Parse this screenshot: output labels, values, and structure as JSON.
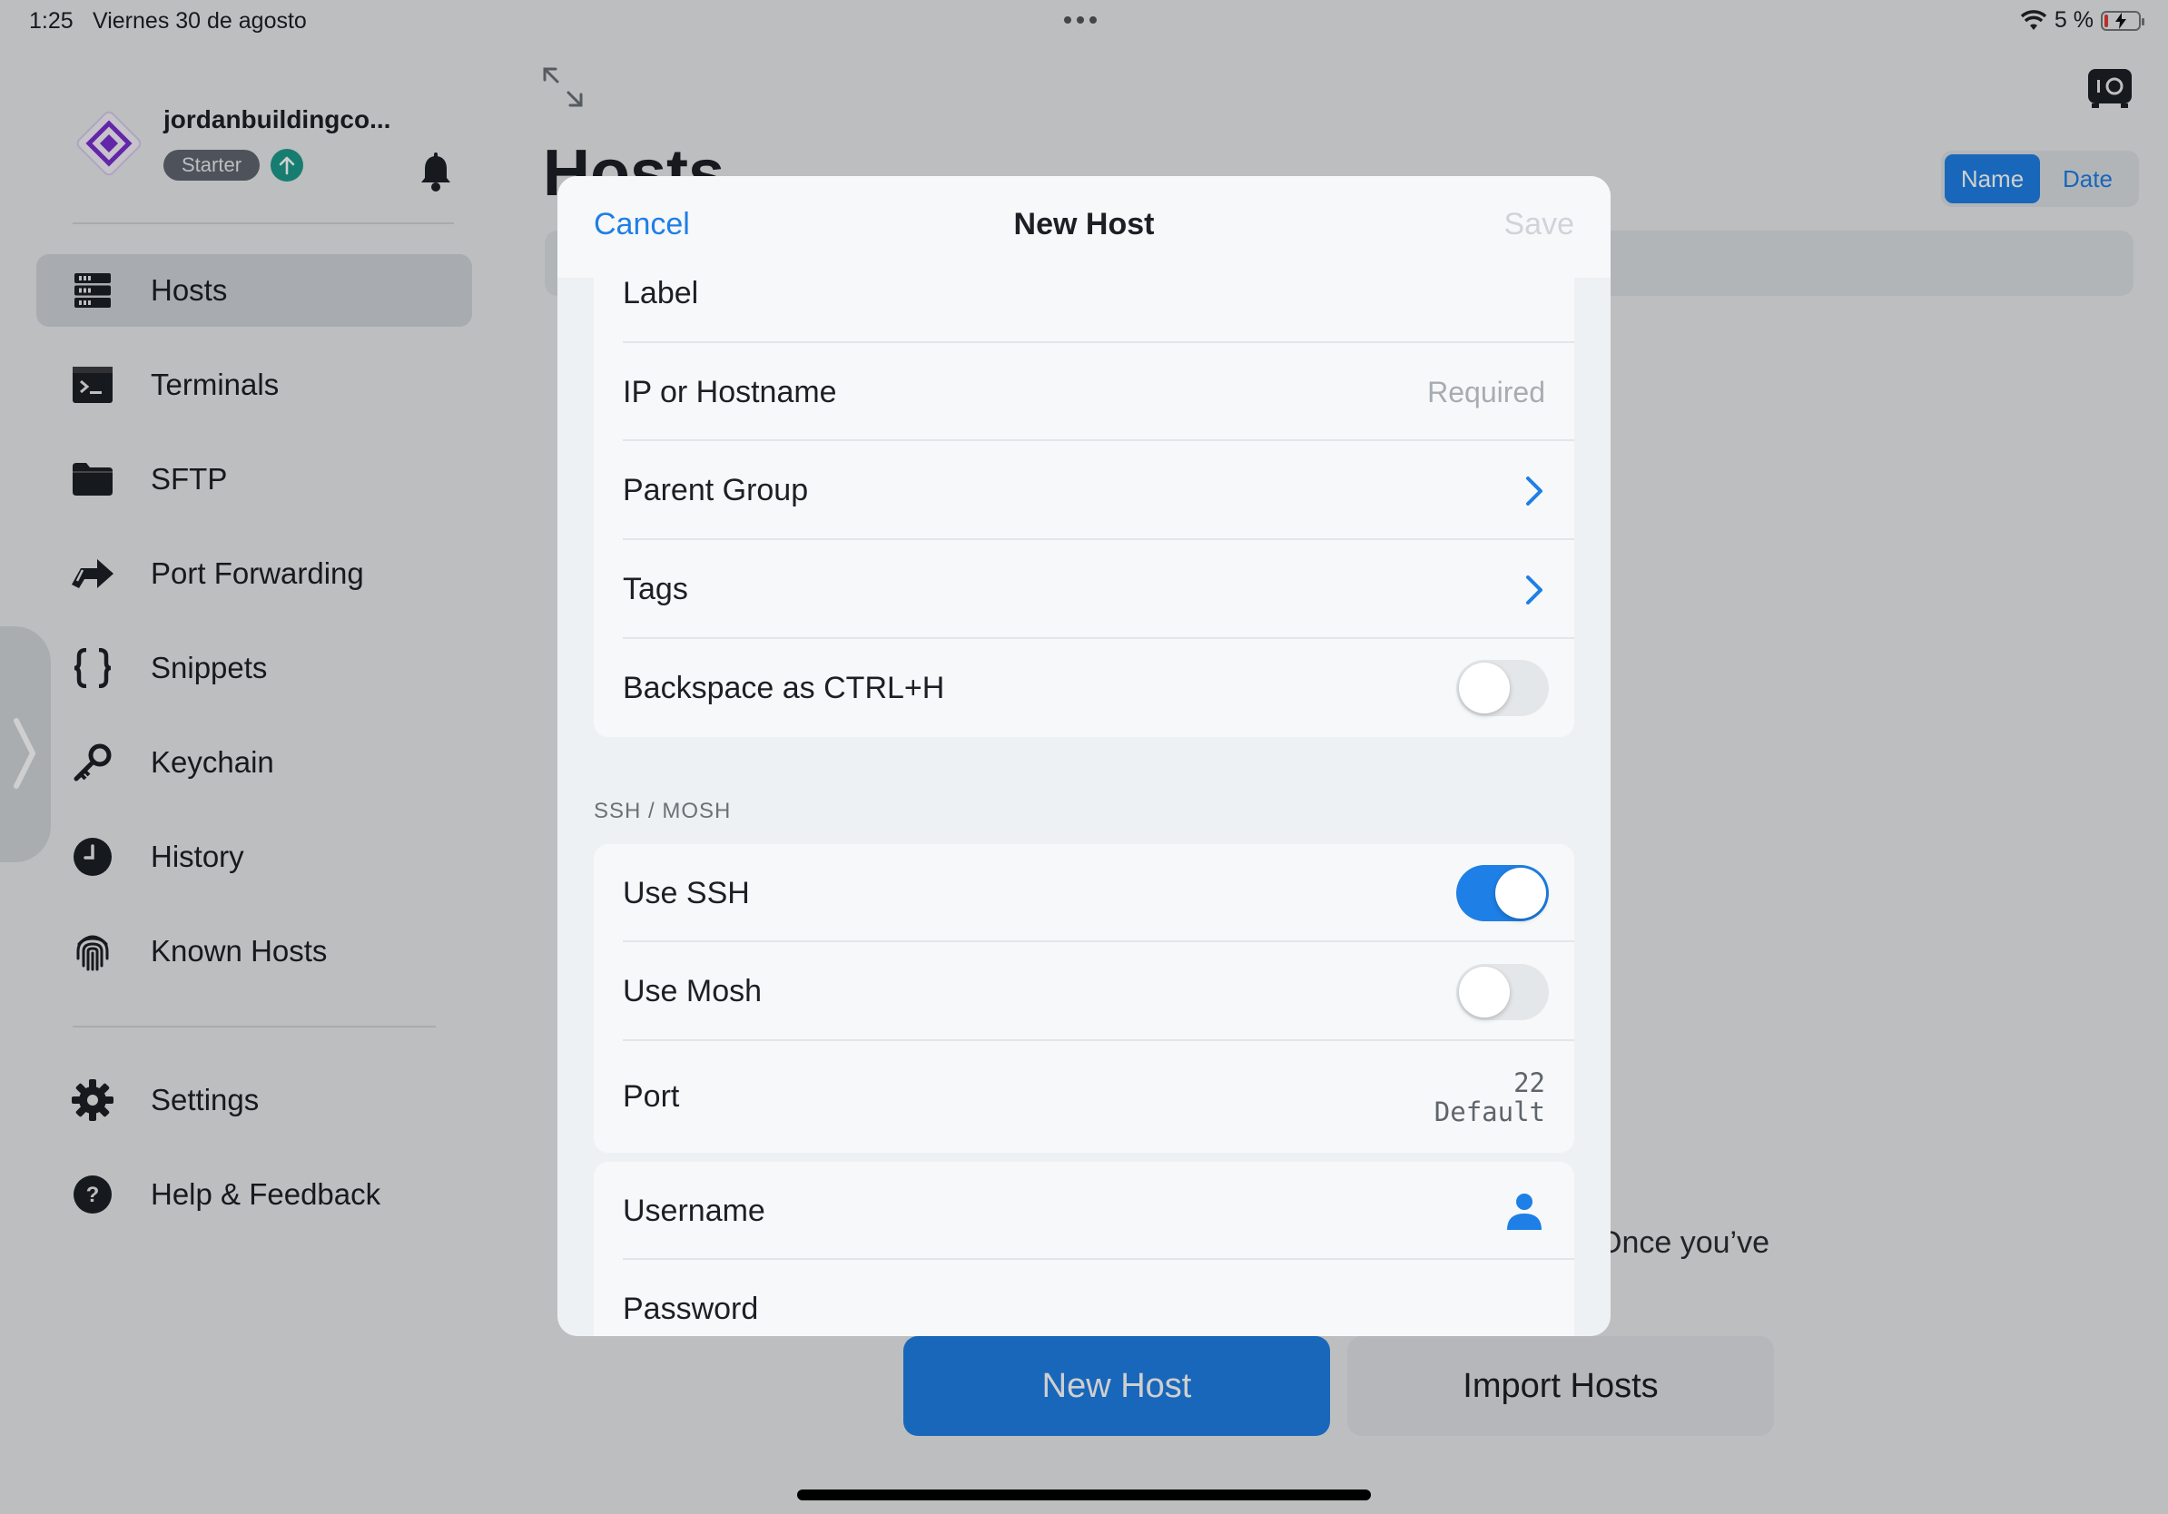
{
  "status_bar": {
    "time": "1:25",
    "date": "Viernes 30 de agosto",
    "battery_percent": "5 %"
  },
  "sidebar": {
    "account_name": "jordanbuildingco...",
    "plan": "Starter",
    "nav_items": [
      {
        "label": "Hosts",
        "icon": "hosts-icon",
        "active": true
      },
      {
        "label": "Terminals",
        "icon": "terminal-icon"
      },
      {
        "label": "SFTP",
        "icon": "folder-icon"
      },
      {
        "label": "Port Forwarding",
        "icon": "port-forwarding-icon"
      },
      {
        "label": "Snippets",
        "icon": "braces-icon"
      },
      {
        "label": "Keychain",
        "icon": "key-icon"
      },
      {
        "label": "History",
        "icon": "clock-icon"
      },
      {
        "label": "Known Hosts",
        "icon": "fingerprint-icon"
      }
    ],
    "footer_items": [
      {
        "label": "Settings",
        "icon": "gear-icon"
      },
      {
        "label": "Help & Feedback",
        "icon": "help-icon"
      }
    ]
  },
  "main": {
    "title": "Hosts",
    "sort_options": [
      "Name",
      "Date"
    ],
    "sort_selected": "Name",
    "empty_state_fragment": "Once you’ve",
    "new_host_button": "New Host",
    "import_hosts_button": "Import Hosts"
  },
  "modal": {
    "cancel": "Cancel",
    "title": "New Host",
    "save": "Save",
    "general_rows": {
      "label": "Label",
      "hostname": "IP or Hostname",
      "hostname_placeholder": "Required",
      "parent_group": "Parent Group",
      "tags": "Tags",
      "backspace": "Backspace as CTRL+H"
    },
    "backspace_on": false,
    "section_ssh": "SSH / MOSH",
    "ssh_rows": {
      "use_ssh": "Use SSH",
      "use_mosh": "Use Mosh",
      "port": "Port",
      "port_value": "22",
      "port_default": "Default"
    },
    "use_ssh_on": true,
    "use_mosh_on": false,
    "credential_rows": {
      "username": "Username",
      "password": "Password"
    }
  },
  "colors": {
    "accent": "#1e7fe6",
    "upgrade_badge": "#1d9a8a",
    "logo": "#7b2fd0"
  }
}
